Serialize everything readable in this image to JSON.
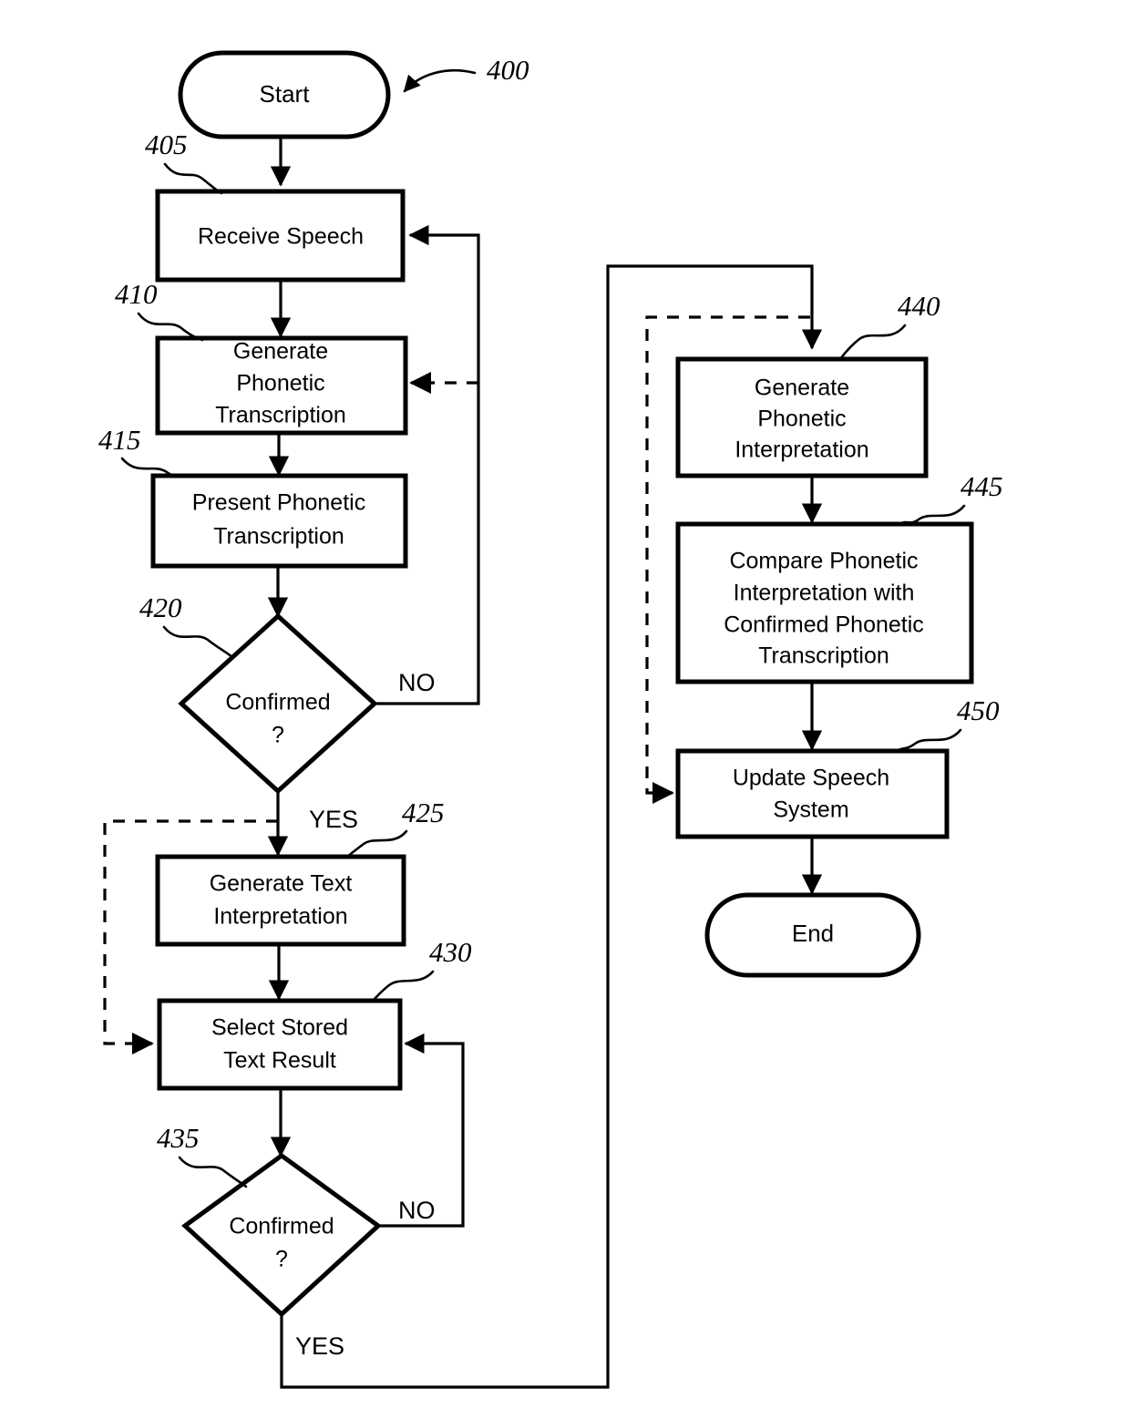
{
  "figure": {
    "figure_number": "400",
    "type": "patent-flowchart",
    "background_color": "#ffffff",
    "line_color": "#000000"
  },
  "nodes": [
    {
      "id": "start",
      "label": "Start",
      "shape": "terminator",
      "ref": null,
      "lines": [
        "Start"
      ]
    },
    {
      "id": "n405",
      "label": "Receive Speech",
      "shape": "process",
      "ref": "405",
      "lines": [
        "Receive Speech"
      ]
    },
    {
      "id": "n410",
      "label": "Generate Phonetic Transcription",
      "shape": "process",
      "ref": "410",
      "lines": [
        "Generate",
        "Phonetic",
        "Transcription"
      ]
    },
    {
      "id": "n415",
      "label": "Present Phonetic Transcription",
      "shape": "process",
      "ref": "415",
      "lines": [
        "Present Phonetic",
        "Transcription"
      ]
    },
    {
      "id": "n420",
      "label": "Confirmed ?",
      "shape": "decision",
      "ref": "420",
      "lines": [
        "Confirmed",
        "?"
      ]
    },
    {
      "id": "n425",
      "label": "Generate Text Interpretation",
      "shape": "process",
      "ref": "425",
      "lines": [
        "Generate Text",
        "Interpretation"
      ]
    },
    {
      "id": "n430",
      "label": "Select Stored Text Result",
      "shape": "process",
      "ref": "430",
      "lines": [
        "Select Stored",
        "Text Result"
      ]
    },
    {
      "id": "n435",
      "label": "Confirmed ?",
      "shape": "decision",
      "ref": "435",
      "lines": [
        "Confirmed",
        "?"
      ]
    },
    {
      "id": "n440",
      "label": "Generate Phonetic Interpretation",
      "shape": "process",
      "ref": "440",
      "lines": [
        "Generate",
        "Phonetic",
        "Interpretation"
      ]
    },
    {
      "id": "n445",
      "label": "Compare Phonetic Interpretation with Confirmed Phonetic Transcription",
      "shape": "process",
      "ref": "445",
      "lines": [
        "Compare Phonetic",
        "Interpretation with",
        "Confirmed Phonetic",
        "Transcription"
      ]
    },
    {
      "id": "n450",
      "label": "Update Speech System",
      "shape": "process",
      "ref": "450",
      "lines": [
        "Update Speech",
        "System"
      ]
    },
    {
      "id": "end",
      "label": "End",
      "shape": "terminator",
      "ref": null,
      "lines": [
        "End"
      ]
    }
  ],
  "branch_labels": {
    "d420_no": "NO",
    "d420_yes": "YES",
    "d435_no": "NO",
    "d435_yes": "YES"
  },
  "reference_numerals": {
    "fig": "400",
    "r405": "405",
    "r410": "410",
    "r415": "415",
    "r420": "420",
    "r425": "425",
    "r430": "430",
    "r435": "435",
    "r440": "440",
    "r445": "445",
    "r450": "450"
  },
  "node_text": {
    "start": "Start",
    "end": "End",
    "n405_l1": "Receive Speech",
    "n410_l1": "Generate",
    "n410_l2": "Phonetic",
    "n410_l3": "Transcription",
    "n415_l1": "Present Phonetic",
    "n415_l2": "Transcription",
    "n420_l1": "Confirmed",
    "n420_l2": "?",
    "n425_l1": "Generate Text",
    "n425_l2": "Interpretation",
    "n430_l1": "Select Stored",
    "n430_l2": "Text Result",
    "n435_l1": "Confirmed",
    "n435_l2": "?",
    "n440_l1": "Generate",
    "n440_l2": "Phonetic",
    "n440_l3": "Interpretation",
    "n445_l1": "Compare Phonetic",
    "n445_l2": "Interpretation with",
    "n445_l3": "Confirmed Phonetic",
    "n445_l4": "Transcription",
    "n450_l1": "Update Speech",
    "n450_l2": "System"
  },
  "edges": [
    {
      "from": "start",
      "to": "n405",
      "style": "solid",
      "label": null
    },
    {
      "from": "n405",
      "to": "n410",
      "style": "solid",
      "label": null
    },
    {
      "from": "n410",
      "to": "n415",
      "style": "solid",
      "label": null
    },
    {
      "from": "n415",
      "to": "n420",
      "style": "solid",
      "label": null
    },
    {
      "from": "n420",
      "to": "n405",
      "style": "solid",
      "label": "NO"
    },
    {
      "from": "n420",
      "to": "n425",
      "style": "solid",
      "label": "YES"
    },
    {
      "from": "n420",
      "to": "n430",
      "style": "dashed",
      "label": null
    },
    {
      "from": "n425",
      "to": "n430",
      "style": "solid",
      "label": null
    },
    {
      "from": "n430",
      "to": "n435",
      "style": "solid",
      "label": null
    },
    {
      "from": "n435",
      "to": "n430",
      "style": "solid",
      "label": "NO"
    },
    {
      "from": "n435",
      "to": "n440",
      "style": "solid",
      "label": "YES"
    },
    {
      "from": "n435",
      "to": "n450",
      "style": "dashed",
      "label": null
    },
    {
      "from": "n440",
      "to": "n445",
      "style": "solid",
      "label": null
    },
    {
      "from": "n445",
      "to": "n450",
      "style": "solid",
      "label": null
    },
    {
      "from": "n450",
      "to": "end",
      "style": "solid",
      "label": null
    },
    {
      "from": "n420_no_line",
      "to": "n410",
      "style": "dashed",
      "label": null
    }
  ]
}
